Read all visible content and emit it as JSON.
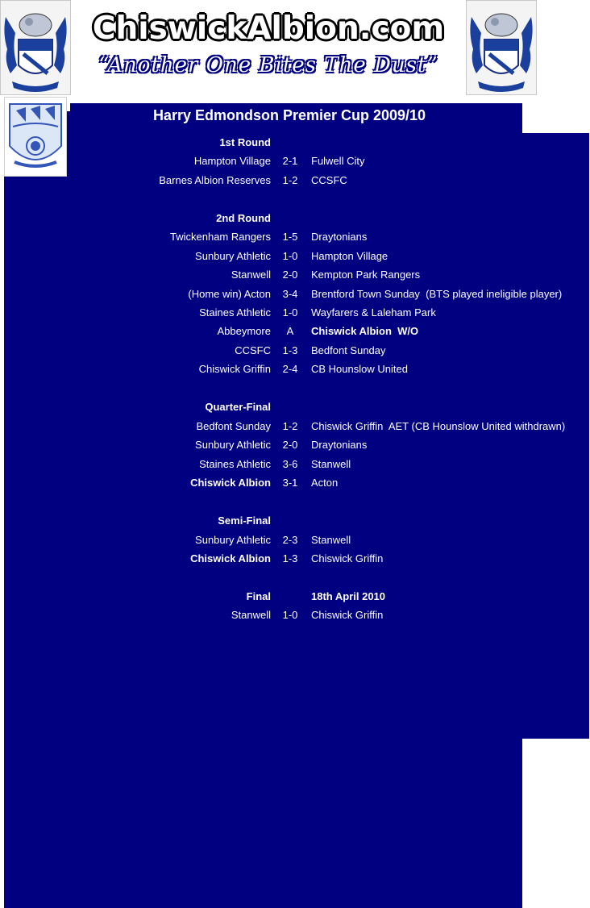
{
  "header": {
    "site_title": "ChiswickAlbion.com",
    "tagline": "“Another One Bites The Dust”"
  },
  "colors": {
    "background": "#000080",
    "text": "#ffffff"
  },
  "competition": {
    "title": "Harry Edmondson Premier Cup 2009/10"
  },
  "rounds": [
    {
      "name": "1st Round",
      "matches": [
        {
          "home": "Hampton Village",
          "score": "2-1",
          "away": "Fulwell City"
        },
        {
          "home": "Barnes Albion Reserves",
          "score": "1-2",
          "away": "CCSFC"
        }
      ]
    },
    {
      "name": "2nd Round",
      "matches": [
        {
          "home": "Twickenham Rangers",
          "score": "1-5",
          "away": "Draytonians"
        },
        {
          "home": "Sunbury Athletic",
          "score": "1-0",
          "away": "Hampton Village"
        },
        {
          "home": "Stanwell",
          "score": "2-0",
          "away": "Kempton Park Rangers"
        },
        {
          "home": "(Home win) Acton",
          "score": "3-4",
          "away": "Brentford Town Sunday  (BTS played ineligible player)"
        },
        {
          "home": "Staines Athletic",
          "score": "1-0",
          "away": "Wayfarers & Laleham Park"
        },
        {
          "home": "Abbeymore",
          "score": "A",
          "away": "Chiswick Albion  W/O",
          "away_bold": true
        },
        {
          "home": "CCSFC",
          "score": "1-3",
          "away": "Bedfont Sunday"
        },
        {
          "home": "Chiswick Griffin",
          "score": "2-4",
          "away": "CB Hounslow United"
        }
      ]
    },
    {
      "name": "Quarter-Final",
      "matches": [
        {
          "home": "Bedfont Sunday",
          "score": "1-2",
          "away": "Chiswick Griffin  AET (CB Hounslow United withdrawn)"
        },
        {
          "home": "Sunbury Athletic",
          "score": "2-0",
          "away": "Draytonians"
        },
        {
          "home": "Staines Athletic",
          "score": "3-6",
          "away": "Stanwell"
        },
        {
          "home": "Chiswick Albion",
          "score": "3-1",
          "away": "Acton",
          "home_bold": true
        }
      ]
    },
    {
      "name": "Semi-Final",
      "matches": [
        {
          "home": "Sunbury Athletic",
          "score": "2-3",
          "away": "Stanwell"
        },
        {
          "home": "Chiswick Albion",
          "score": "1-3",
          "away": "Chiswick Griffin",
          "home_bold": true
        }
      ]
    },
    {
      "name": "Final",
      "date": "18th April 2010",
      "matches": [
        {
          "home": "Stanwell",
          "score": "1-0",
          "away": "Chiswick Griffin"
        }
      ]
    }
  ]
}
